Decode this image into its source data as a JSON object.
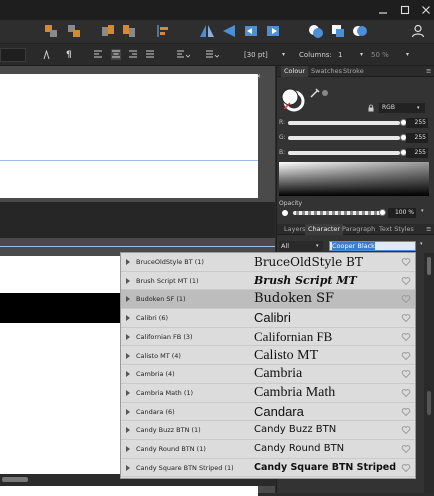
{
  "context_bar": {
    "pt_value": "[30 pt]",
    "columns_label": "Columns:",
    "columns_value": "1",
    "percent_value": "50 %"
  },
  "colour_panel": {
    "tabs": [
      "Colour",
      "Swatches",
      "Stroke"
    ],
    "mode": "RGB",
    "channels": [
      {
        "label": "R:",
        "value": "255"
      },
      {
        "label": "G:",
        "value": "255"
      },
      {
        "label": "B:",
        "value": "255"
      }
    ],
    "opacity_label": "Opacity",
    "opacity_value": "100 %"
  },
  "character_panel": {
    "tabs": [
      "Layers",
      "Character",
      "Paragraph",
      "Text Styles"
    ],
    "category": "All",
    "font_search": "Cooper Black"
  },
  "font_list": [
    {
      "name": "BruceOldStyle BT (1)",
      "preview": "BruceOldStyle BT",
      "selected": false
    },
    {
      "name": "Brush Script MT (1)",
      "preview": "Brush Script MT",
      "selected": false
    },
    {
      "name": "Budoken SF (1)",
      "preview": "Budoken SF",
      "selected": true
    },
    {
      "name": "Calibri (6)",
      "preview": "Calibri",
      "selected": false
    },
    {
      "name": "Californian FB (3)",
      "preview": "Californian FB",
      "selected": false
    },
    {
      "name": "Calisto MT (4)",
      "preview": "Calisto MT",
      "selected": false
    },
    {
      "name": "Cambria (4)",
      "preview": "Cambria",
      "selected": false
    },
    {
      "name": "Cambria Math (1)",
      "preview": "Cambria Math",
      "selected": false
    },
    {
      "name": "Candara (6)",
      "preview": "Candara",
      "selected": false
    },
    {
      "name": "Candy Buzz BTN (1)",
      "preview": "Candy Buzz BTN",
      "selected": false
    },
    {
      "name": "Candy Round BTN (1)",
      "preview": "Candy Round BTN",
      "selected": false
    },
    {
      "name": "Candy Square BTN Striped (1)",
      "preview": "Candy Square BTN Striped",
      "selected": false
    }
  ],
  "colors": {
    "accent_blue": "#4a90d9",
    "accent_orange": "#e08a2a",
    "selection_bg": "#bdbdbd"
  }
}
